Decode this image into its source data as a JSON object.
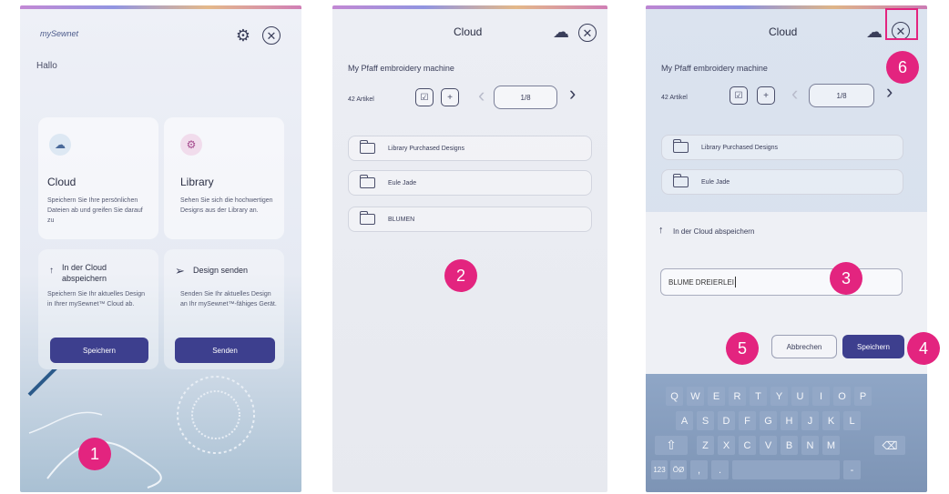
{
  "screen1": {
    "logo": "mySewnet",
    "greeting": "Hallo",
    "cloud_card": {
      "title": "Cloud",
      "desc": "Speichern Sie Ihre persönlichen Dateien ab und greifen Sie darauf zu"
    },
    "library_card": {
      "title": "Library",
      "desc": "Sehen Sie sich die hochwertigen Designs aus der Library an."
    },
    "save_card": {
      "title": "In der Cloud abspeichern",
      "desc": "Speichern Sie Ihr aktuelles Design in Ihrer mySewnet™ Cloud ab.",
      "button": "Speichern"
    },
    "send_card": {
      "title": "Design senden",
      "desc": "Senden Sie Ihr aktuelles Design an Ihr mySewnet™-fähiges Gerät.",
      "button": "Senden"
    }
  },
  "screen2": {
    "title": "Cloud",
    "machine": "My Pfaff embroidery machine",
    "count": "42 Artikel",
    "page": "1/8",
    "folders": [
      "Library Purchased Designs",
      "Eule Jade",
      "BLUMEN"
    ]
  },
  "screen3": {
    "title": "Cloud",
    "machine": "My Pfaff embroidery machine",
    "count": "42 Artikel",
    "page": "1/8",
    "folders": [
      "Library Purchased Designs",
      "Eule Jade"
    ],
    "save_heading": "In der Cloud abspeichern",
    "filename_value": "BLUME DREIERLEI",
    "cancel_label": "Abbrechen",
    "save_label": "Speichern",
    "keyboard": {
      "row1": [
        "Q",
        "W",
        "E",
        "R",
        "T",
        "Y",
        "U",
        "I",
        "O",
        "P"
      ],
      "row2": [
        "A",
        "S",
        "D",
        "F",
        "G",
        "H",
        "J",
        "K",
        "L"
      ],
      "row3": [
        "Z",
        "X",
        "C",
        "V",
        "B",
        "N",
        "M"
      ],
      "num_key": "123",
      "lang_key": "ÖØ",
      "comma_key": ",",
      "period_key": ".",
      "dash_key": "-"
    }
  },
  "markers": [
    "1",
    "2",
    "3",
    "4",
    "5",
    "6"
  ],
  "colors": {
    "accent": "#3d3f8e",
    "marker": "#e3247f"
  }
}
